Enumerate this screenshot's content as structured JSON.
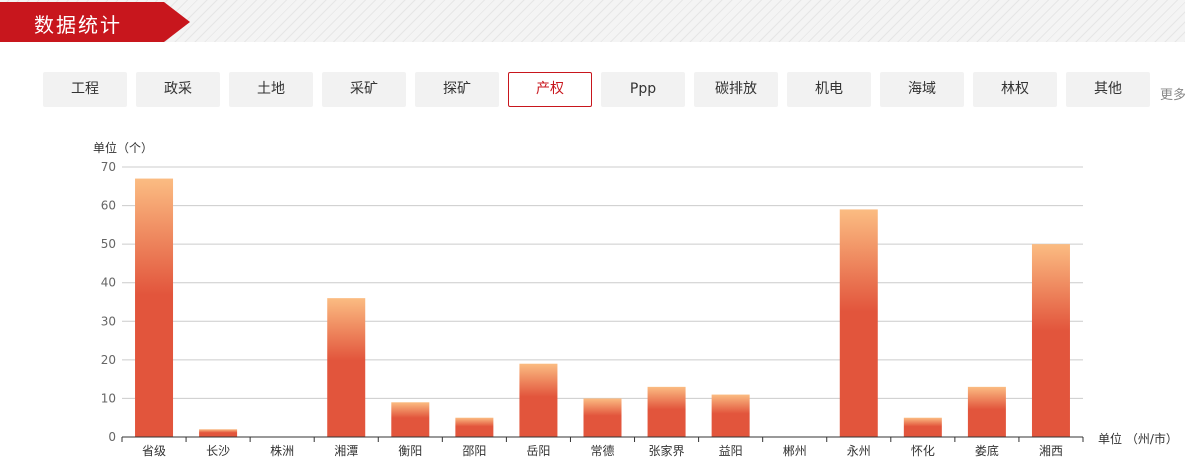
{
  "header": {
    "title": "数据统计"
  },
  "tabs": [
    {
      "label": "工程",
      "active": false
    },
    {
      "label": "政采",
      "active": false
    },
    {
      "label": "土地",
      "active": false
    },
    {
      "label": "采矿",
      "active": false
    },
    {
      "label": "探矿",
      "active": false
    },
    {
      "label": "产权",
      "active": true
    },
    {
      "label": "Ppp",
      "active": false
    },
    {
      "label": "碳排放",
      "active": false
    },
    {
      "label": "机电",
      "active": false
    },
    {
      "label": "海域",
      "active": false
    },
    {
      "label": "林权",
      "active": false
    },
    {
      "label": "其他",
      "active": false
    }
  ],
  "more_label": "更多",
  "colors": {
    "brand": "#c8161d",
    "bar_top": "#fbbc82",
    "bar_bottom": "#e2553c"
  },
  "chart_data": {
    "type": "bar",
    "ylabel": "单位（个）",
    "xlabel": "单位 （州/市）",
    "ylim": [
      0,
      70
    ],
    "yticks": [
      0,
      10,
      20,
      30,
      40,
      50,
      60,
      70
    ],
    "grid": true,
    "categories": [
      "省级",
      "长沙",
      "株洲",
      "湘潭",
      "衡阳",
      "邵阳",
      "岳阳",
      "常德",
      "张家界",
      "益阳",
      "郴州",
      "永州",
      "怀化",
      "娄底",
      "湘西"
    ],
    "values": [
      67,
      2,
      0,
      36,
      9,
      5,
      19,
      10,
      13,
      11,
      0,
      59,
      5,
      13,
      50
    ]
  }
}
